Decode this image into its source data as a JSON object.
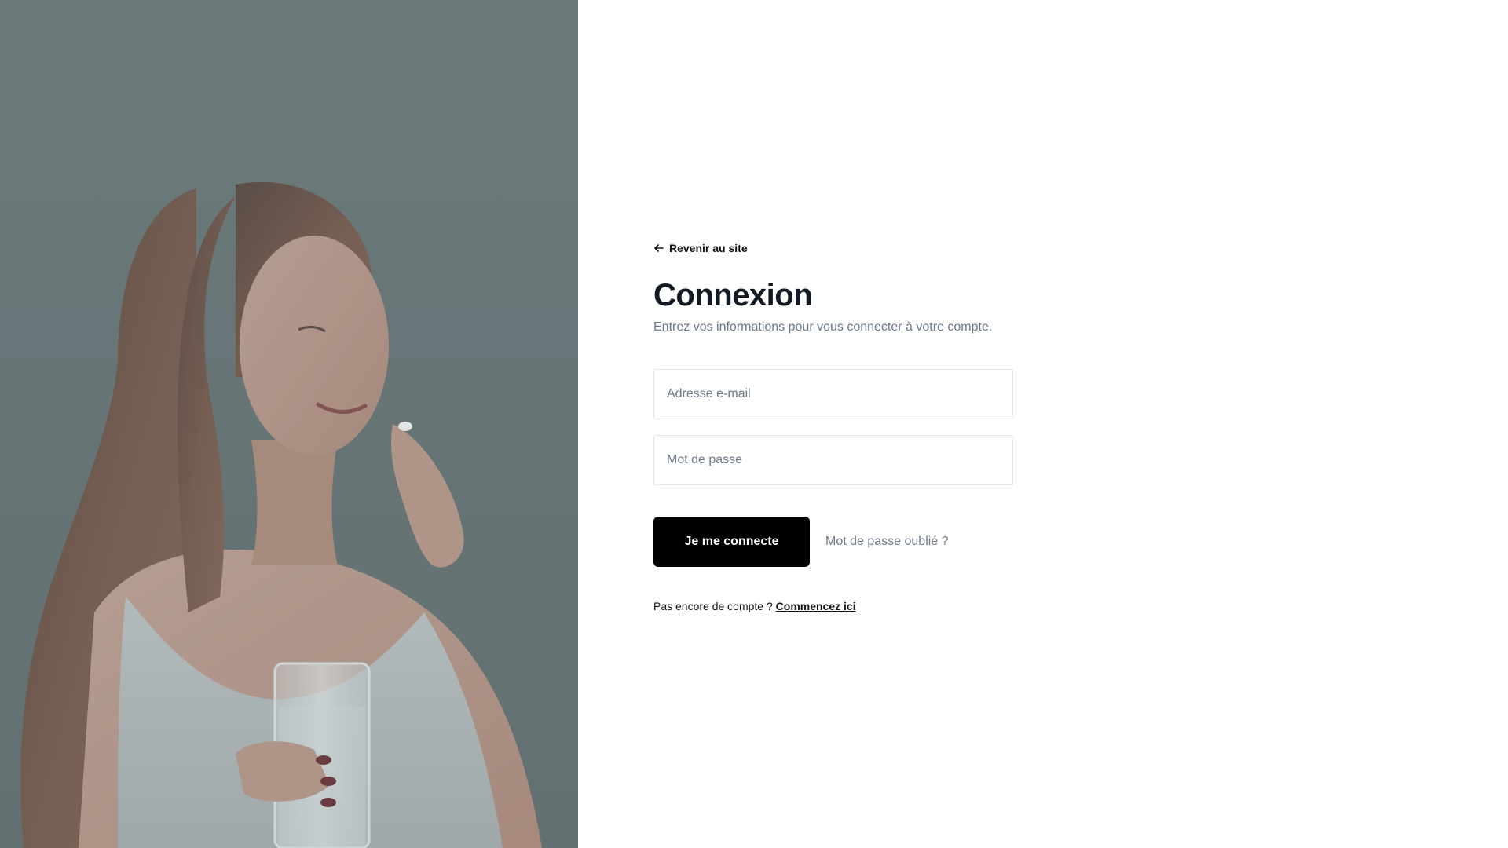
{
  "hero": {
    "image": "woman-holding-pill-and-water-glass"
  },
  "back_link": {
    "label": "Revenir au site",
    "icon": "arrow-left-icon"
  },
  "login": {
    "title": "Connexion",
    "subtitle": "Entrez vos informations pour vous connecter à votre compte.",
    "email_placeholder": "Adresse e-mail",
    "email_value": "",
    "password_placeholder": "Mot de passe",
    "password_value": "",
    "submit_label": "Je me connecte",
    "forgot_label": "Mot de passe oublié ?"
  },
  "signup": {
    "prompt": "Pas encore de compte ?",
    "link_label": "Commencez ici"
  },
  "colors": {
    "primary_button": "#000000",
    "title": "#141a24",
    "muted_text": "#69768a",
    "field_border": "#e2e5ea",
    "hero_overlay": "#6a7779"
  }
}
